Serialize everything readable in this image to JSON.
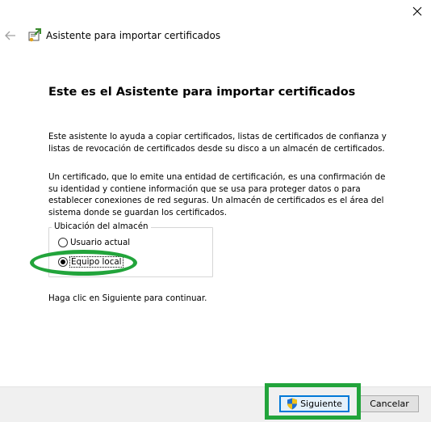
{
  "window": {
    "title": "Asistente para importar certificados",
    "close_icon": "close-icon",
    "back_icon": "back-arrow-icon",
    "app_icon": "certificate-import-wizard-icon"
  },
  "main": {
    "heading": "Este es el Asistente para importar certificados",
    "paragraph1": "Este asistente lo ayuda a copiar certificados, listas de certificados de confianza y listas de revocación de certificados desde su disco a un almacén de certificados.",
    "paragraph2": "Un certificado, que lo emite una entidad de certificación, es una confirmación de su identidad y contiene información que se usa para proteger datos o para establecer conexiones de red seguras. Un almacén de certificados es el área del sistema donde se guardan los certificados.",
    "store_location": {
      "legend": "Ubicación del almacén",
      "options": [
        {
          "label": "Usuario actual",
          "selected": false
        },
        {
          "label": "Equipo local",
          "selected": true
        }
      ]
    },
    "instruction": "Haga clic en Siguiente para continuar."
  },
  "footer": {
    "next_label": "Siguiente",
    "next_icon": "uac-shield-icon",
    "cancel_label": "Cancelar"
  },
  "annotations": {
    "highlight_color": "#22a43b",
    "accent_color": "#0078d7"
  }
}
